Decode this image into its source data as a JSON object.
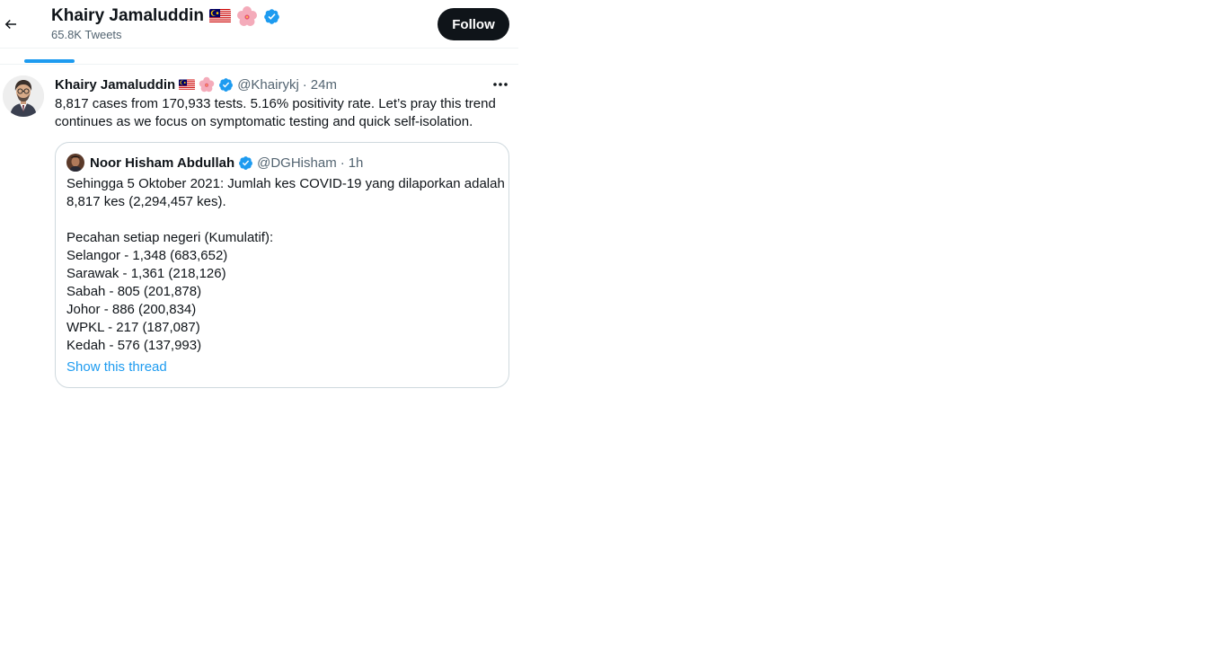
{
  "header": {
    "back_icon": "arrow-left-icon",
    "name": "Khairy Jamaluddin",
    "badges": [
      "malaysia-flag-icon",
      "hibiscus-icon",
      "verified-badge-icon"
    ],
    "tweet_count": "65.8K Tweets",
    "follow_label": "Follow"
  },
  "tweet": {
    "author_name": "Khairy Jamaluddin",
    "handle": "@Khairykj",
    "separator": "·",
    "time": "24m",
    "text": "8,817 cases from 170,933 tests. 5.16% positivity rate. Let’s pray this trend continues as we focus on symptomatic testing and quick self-isolation.",
    "quote": {
      "author_name": "Noor Hisham Abdullah",
      "handle": "@DGHisham",
      "separator": "·",
      "time": "1h",
      "lines": [
        "Sehingga 5 Oktober 2021: Jumlah kes COVID-19 yang dilaporkan adalah",
        "8,817 kes (2,294,457 kes).",
        "",
        "Pecahan setiap negeri (Kumulatif):",
        "Selangor - 1,348 (683,652)",
        "Sarawak - 1,361 (218,126)",
        "Sabah - 805 (201,878)",
        "Johor - 886 (200,834)",
        "WPKL - 217 (187,087)",
        "Kedah - 576 (137,993)"
      ],
      "show_thread": "Show this thread"
    }
  },
  "colors": {
    "accent": "#1d9bf0",
    "text": "#0f1419",
    "muted": "#536471",
    "border": "#cfd9de"
  }
}
